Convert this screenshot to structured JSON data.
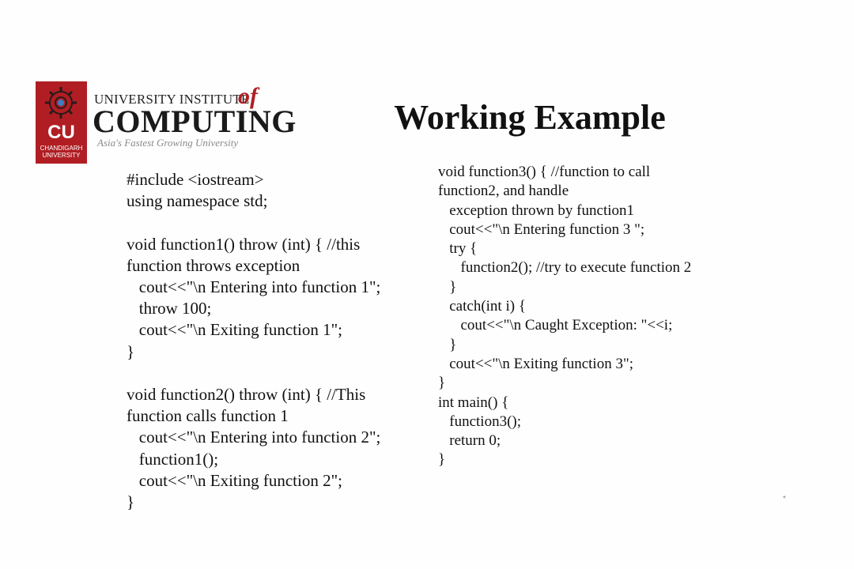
{
  "logo": {
    "emblem_text": "CU",
    "emblem_sub_line1": "CHANDIGARH",
    "emblem_sub_line2": "UNIVERSITY",
    "line1": "UNIVERSITY INSTITUTE",
    "of": "of",
    "line2": "COMPUTING",
    "tagline": "Asia's Fastest Growing University",
    "colors": {
      "brand_red": "#b01e23",
      "dark": "#1a1a1a",
      "muted": "#8a8a8a"
    }
  },
  "title": "Working Example",
  "code_left": [
    "#include <iostream>",
    "using namespace std;",
    "",
    "void function1() throw (int) { //this",
    "function throws exception",
    "   cout<<\"\\n Entering into function 1\";",
    "   throw 100;",
    "   cout<<\"\\n Exiting function 1\";",
    "}",
    "",
    "void function2() throw (int) { //This",
    "function calls function 1",
    "   cout<<\"\\n Entering into function 2\";",
    "   function1();",
    "   cout<<\"\\n Exiting function 2\";",
    "}"
  ],
  "code_right": [
    "void function3() { //function to call",
    "function2, and handle",
    "   exception thrown by function1",
    "   cout<<\"\\n Entering function 3 \";",
    "   try {",
    "      function2(); //try to execute function 2",
    "   }",
    "   catch(int i) {",
    "      cout<<\"\\n Caught Exception: \"<<i;",
    "   }",
    "   cout<<\"\\n Exiting function 3\";",
    "}",
    "int main() {",
    "   function3();",
    "   return 0;",
    "}"
  ],
  "corner_marker": "*"
}
